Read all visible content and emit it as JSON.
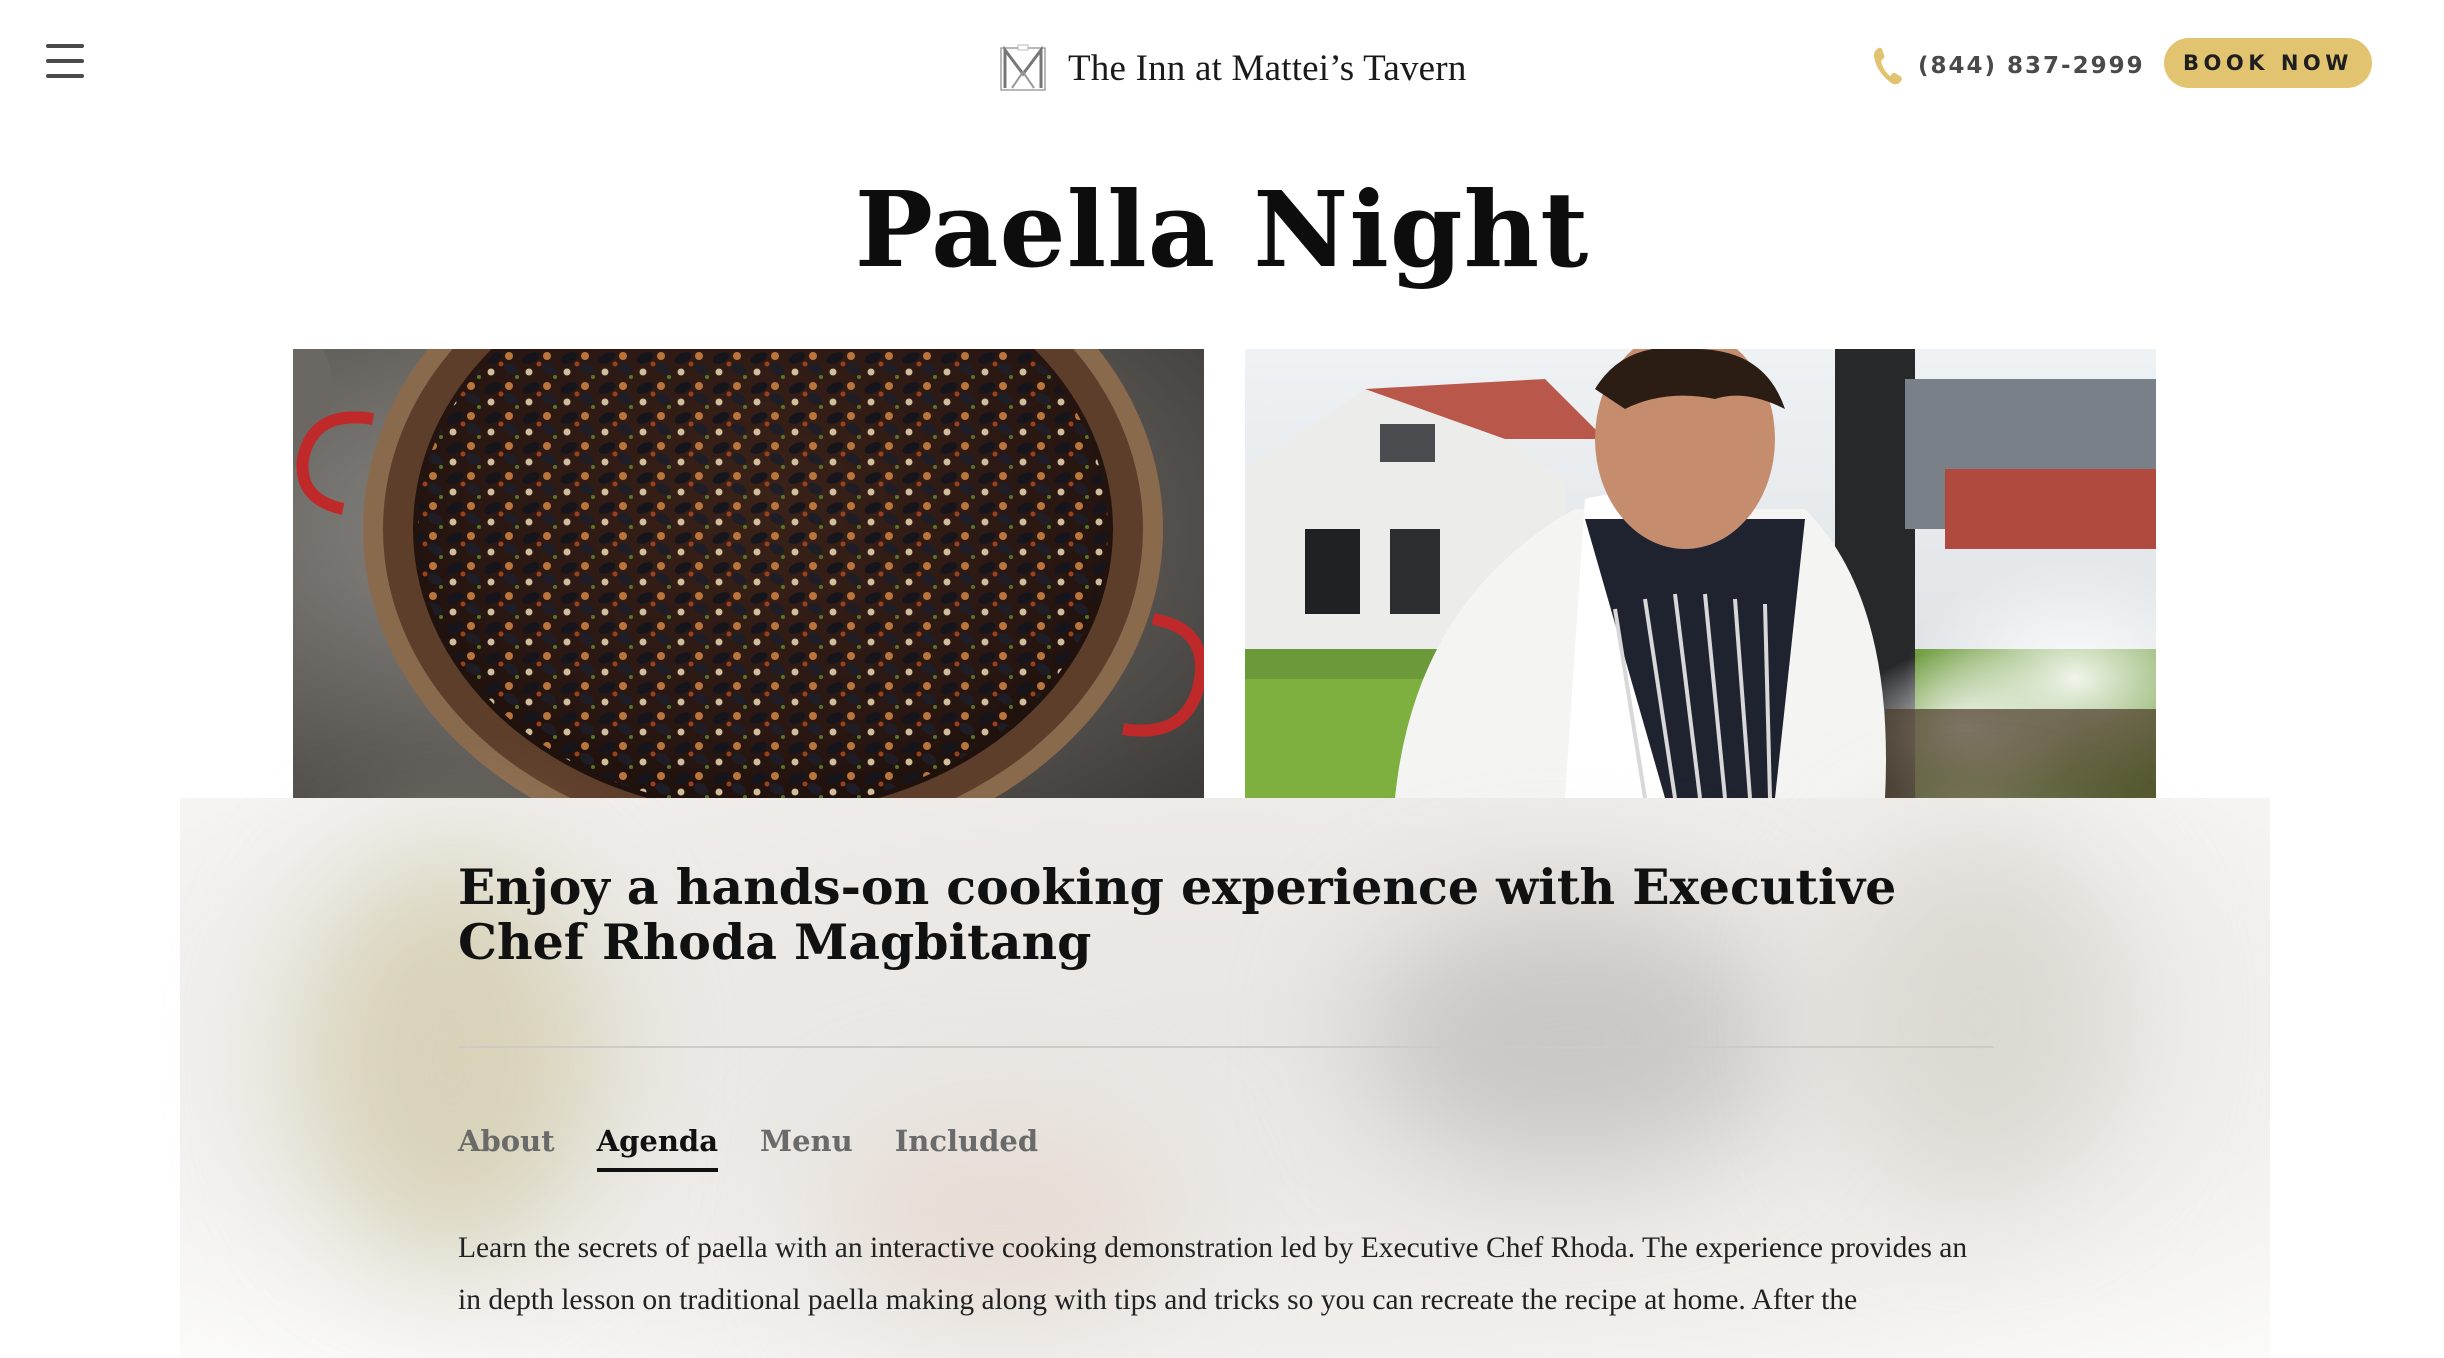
{
  "header": {
    "brand_name": "The Inn at Mattei’s Tavern",
    "phone": "(844) 837-2999",
    "book_label": "BOOK NOW"
  },
  "page": {
    "title": "Paella Night"
  },
  "event": {
    "subtitle": "Enjoy a hands-on cooking experience with Executive Chef Rhoda Magbitang",
    "tabs": [
      {
        "label": "About",
        "active": false
      },
      {
        "label": "Agenda",
        "active": true
      },
      {
        "label": "Menu",
        "active": false
      },
      {
        "label": "Included",
        "active": false
      }
    ],
    "description": "Learn the secrets of paella with an interactive cooking demonstration led by Executive Chef Rhoda. The experience provides an in depth lesson on traditional paella making along with tips and tricks so you can recreate the recipe at home. After the"
  },
  "colors": {
    "accent": "#e2c470",
    "text": "#111111",
    "muted_text": "#6a6a6a"
  },
  "icons": {
    "menu": "hamburger-icon",
    "phone": "phone-icon",
    "logo": "mattei-monogram-icon"
  }
}
